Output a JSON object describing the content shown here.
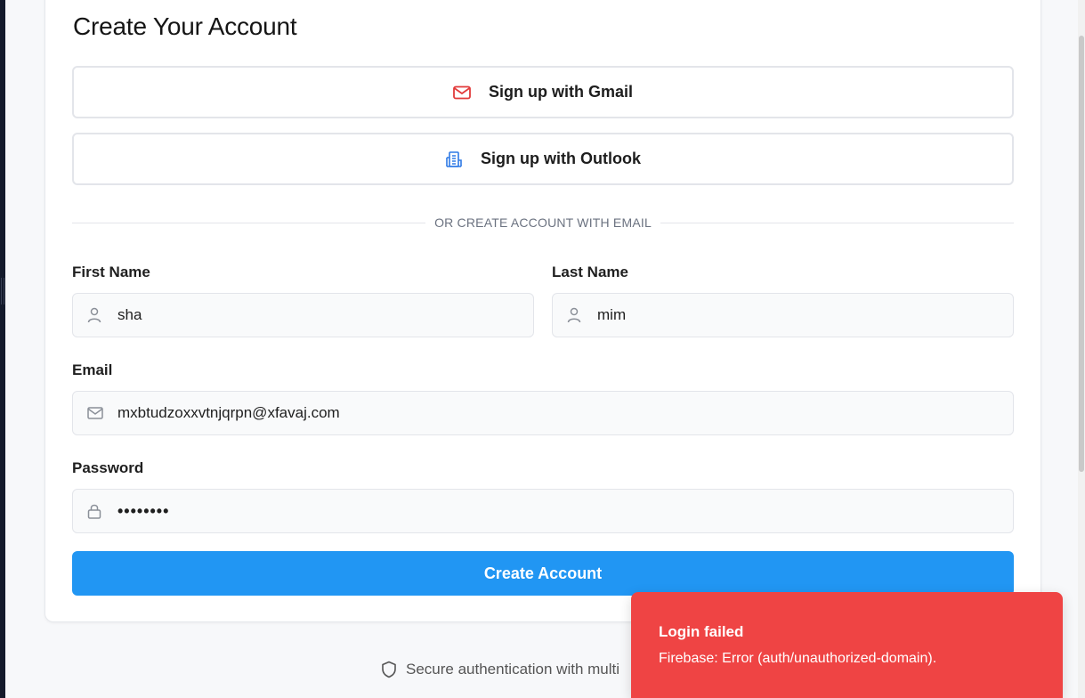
{
  "page": {
    "title": "Create Your Account"
  },
  "social": {
    "gmail_label": "Sign up with Gmail",
    "gmail_icon": "mail-icon",
    "outlook_label": "Sign up with Outlook",
    "outlook_icon": "building-icon"
  },
  "divider": {
    "text": "OR CREATE ACCOUNT WITH EMAIL"
  },
  "form": {
    "first_name": {
      "label": "First Name",
      "value": "sha",
      "icon": "user-icon"
    },
    "last_name": {
      "label": "Last Name",
      "value": "mim",
      "icon": "user-icon"
    },
    "email": {
      "label": "Email",
      "value": "mxbtudzoxxvtnjqrpn@xfavaj.com",
      "icon": "mail-icon"
    },
    "password": {
      "label": "Password",
      "value": "••••••••",
      "icon": "lock-icon"
    },
    "submit_label": "Create Account"
  },
  "footer": {
    "secure_text": "Secure authentication with multi",
    "icon": "shield-icon"
  },
  "toast": {
    "title": "Login failed",
    "message": "Firebase: Error (auth/unauthorized-domain)."
  },
  "colors": {
    "primary": "#2196f3",
    "error": "#ef4444",
    "gmail_icon": "#e23b3b",
    "outlook_icon": "#2f7ae5"
  }
}
